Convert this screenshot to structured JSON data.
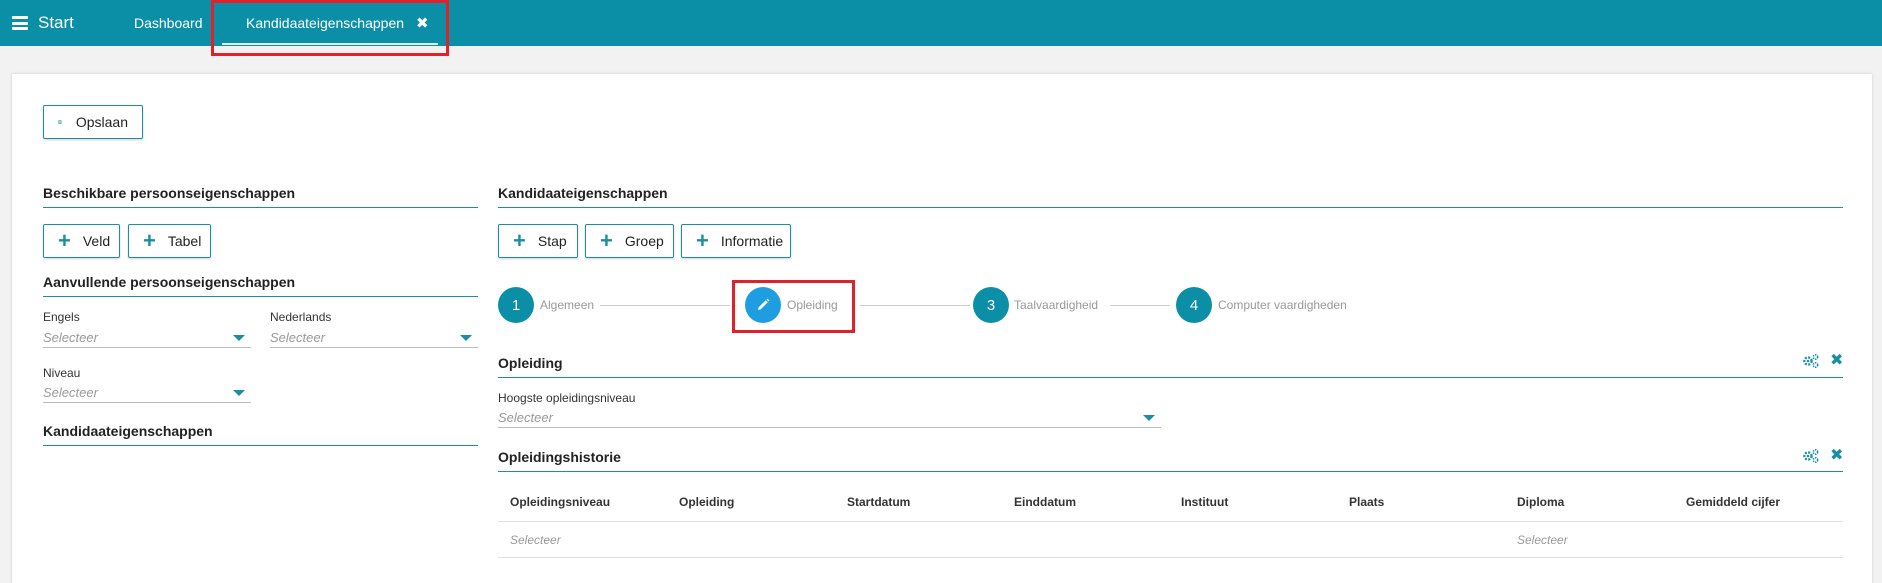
{
  "nav": {
    "menu_label": "Start",
    "tabs": [
      {
        "label": "Dashboard"
      },
      {
        "label": "Kandidaateigenschappen",
        "close": "✖"
      }
    ]
  },
  "toolbar": {
    "save_label": "Opslaan"
  },
  "left": {
    "available_title": "Beschikbare persoonseigenschappen",
    "add_field_label": "Veld",
    "add_table_label": "Tabel",
    "additional_title": "Aanvullende persoonseigenschappen",
    "fields": [
      {
        "label": "Engels",
        "placeholder": "Selecteer"
      },
      {
        "label": "Nederlands",
        "placeholder": "Selecteer"
      },
      {
        "label": "Niveau",
        "placeholder": "Selecteer"
      }
    ],
    "candidate_title": "Kandidaateigenschappen"
  },
  "right": {
    "title": "Kandidaateigenschappen",
    "add_step_label": "Stap",
    "add_group_label": "Groep",
    "add_info_label": "Informatie",
    "steps": [
      {
        "number": "1",
        "label": "Algemeen"
      },
      {
        "number": "",
        "label": "Opleiding",
        "active": true
      },
      {
        "number": "3",
        "label": "Taalvaardigheid"
      },
      {
        "number": "4",
        "label": "Computer vaardigheden"
      }
    ],
    "education_group": {
      "title": "Opleiding",
      "field_label": "Hoogste opleidingsniveau",
      "field_placeholder": "Selecteer"
    },
    "history_group": {
      "title": "Opleidingshistorie",
      "columns": [
        "Opleidingsniveau",
        "Opleiding",
        "Startdatum",
        "Einddatum",
        "Instituut",
        "Plaats",
        "Diploma",
        "Gemiddeld cijfer"
      ],
      "row": {
        "col1": "Selecteer",
        "col7": "Selecteer"
      }
    }
  },
  "colors": {
    "brand": "#0a8fa6",
    "accent": "#1a8fa3",
    "active_step": "#1e9ee0",
    "highlight": "#e0202a"
  }
}
